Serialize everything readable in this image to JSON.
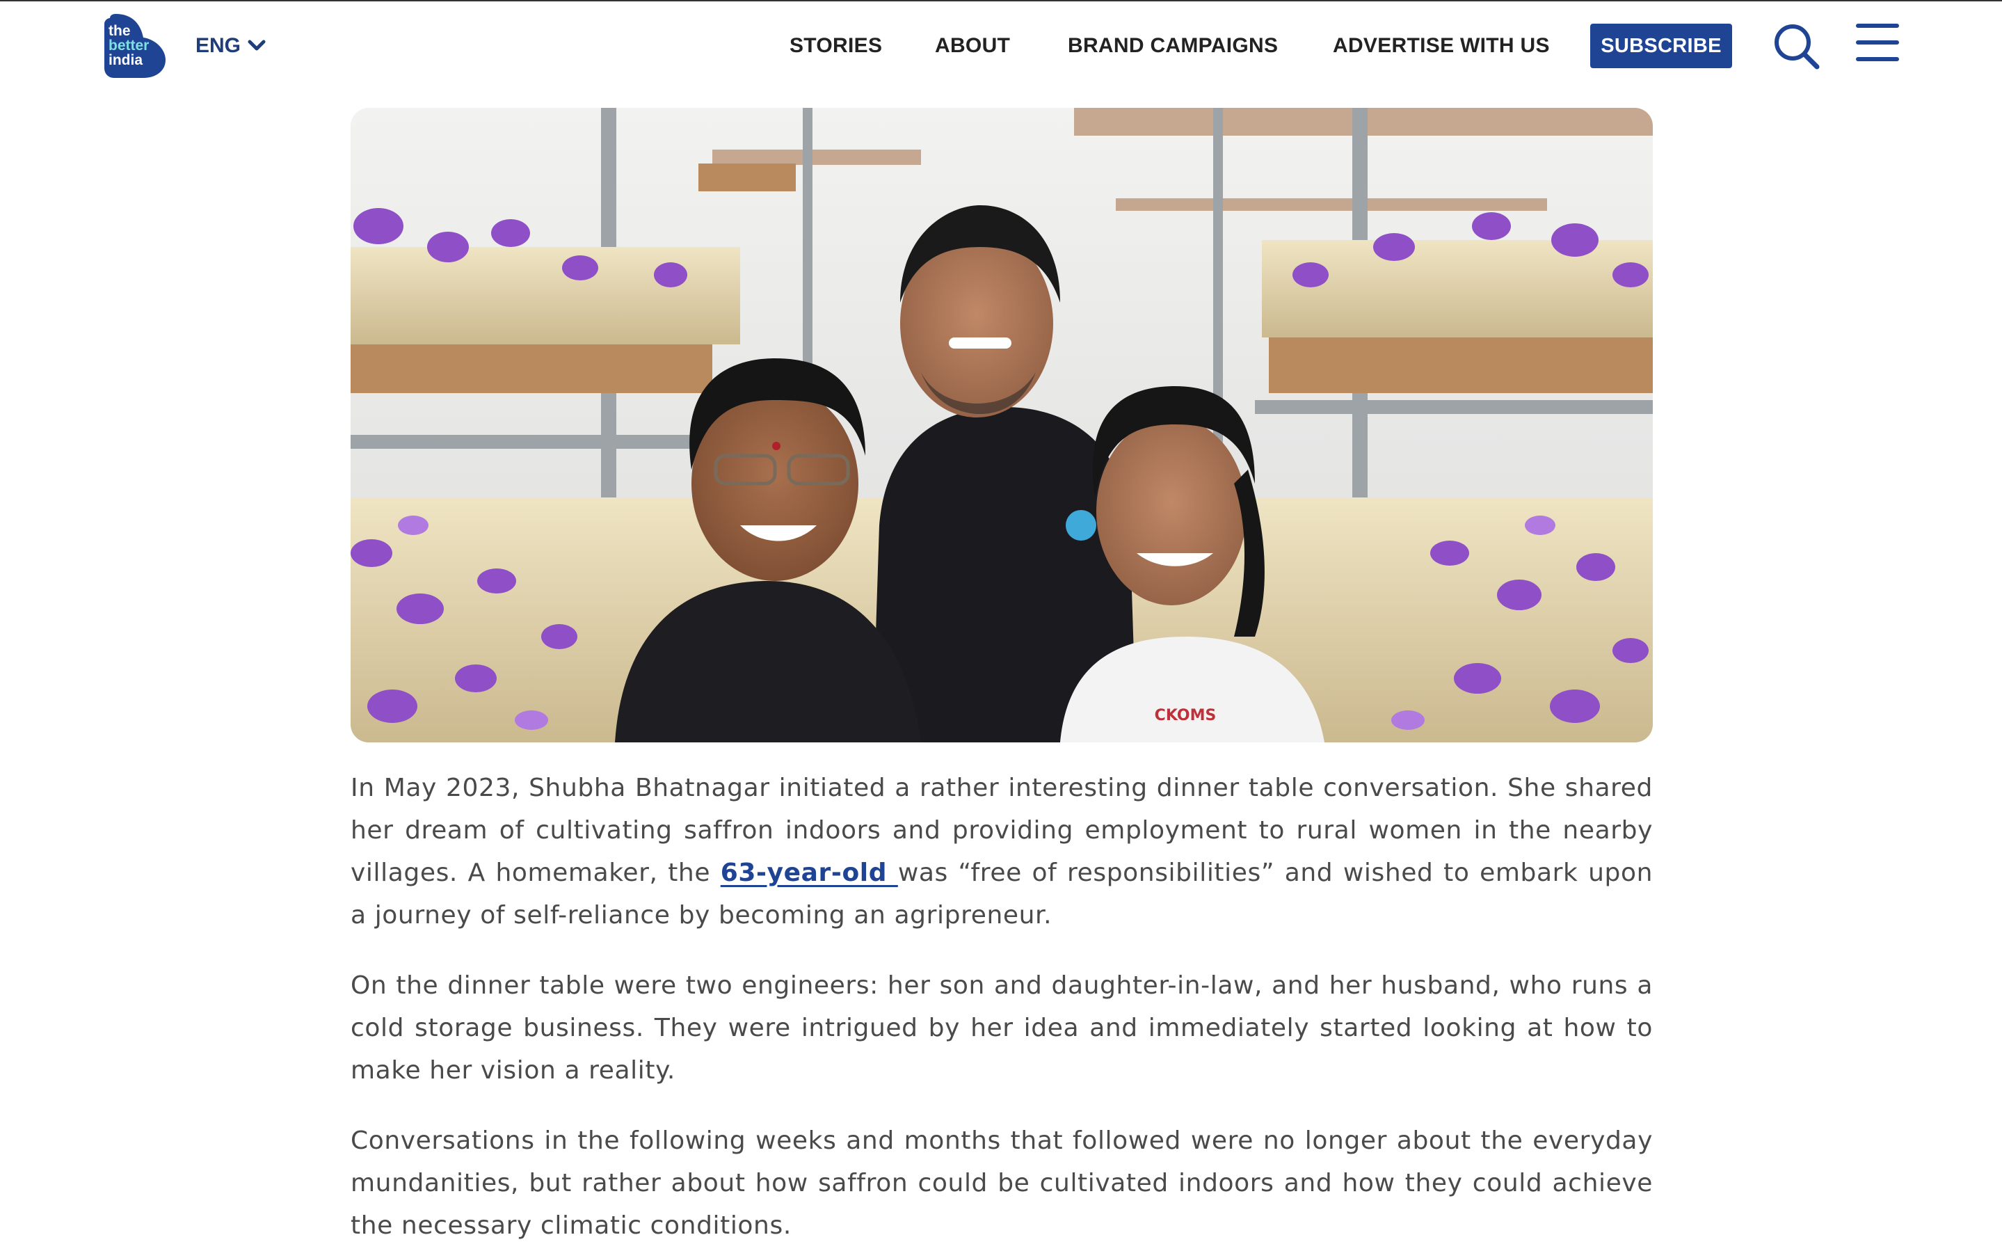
{
  "header": {
    "logo": {
      "line1": "the",
      "line2": "better",
      "line3": "india"
    },
    "language": {
      "label": "ENG",
      "icon": "chevron-down-icon"
    },
    "nav": [
      {
        "label": "STORIES"
      },
      {
        "label": "ABOUT"
      },
      {
        "label": "BRAND CAMPAIGNS"
      },
      {
        "label": "ADVERTISE WITH US"
      }
    ],
    "subscribe_label": "SUBSCRIBE",
    "search_icon": "search-icon",
    "menu_icon": "hamburger-menu-icon"
  },
  "colors": {
    "brand_blue": "#1f4494",
    "text": "#4a4a4a",
    "nav_text": "#222222",
    "saffron_purple": "#8e4fc7"
  },
  "hero_image": {
    "alt": "Three people smiling among indoor saffron flowers on metal shelves",
    "shirt_logo_text": "CKOMS"
  },
  "article": {
    "p1_before": "In May 2023, Shubha Bhatnagar initiated a rather interesting dinner table conversation. She shared her dream of cultivating saffron indoors and providing employment to rural women in the nearby villages. A homemaker, the ",
    "p1_link": "63-year-old ",
    "p1_after": "was “free of responsibilities” and wished to embark upon a journey of self-reliance by becoming an agripreneur.",
    "p2": "On the dinner table were two engineers: her son and daughter-in-law, and her husband, who runs a cold storage business. They were intrigued by her idea and immediately started looking at how to make her vision a reality.",
    "p3": "Conversations in the following weeks and months that followed were no longer about the everyday mundanities, but rather about how saffron could be cultivated indoors and how they could achieve the necessary climatic conditions."
  }
}
